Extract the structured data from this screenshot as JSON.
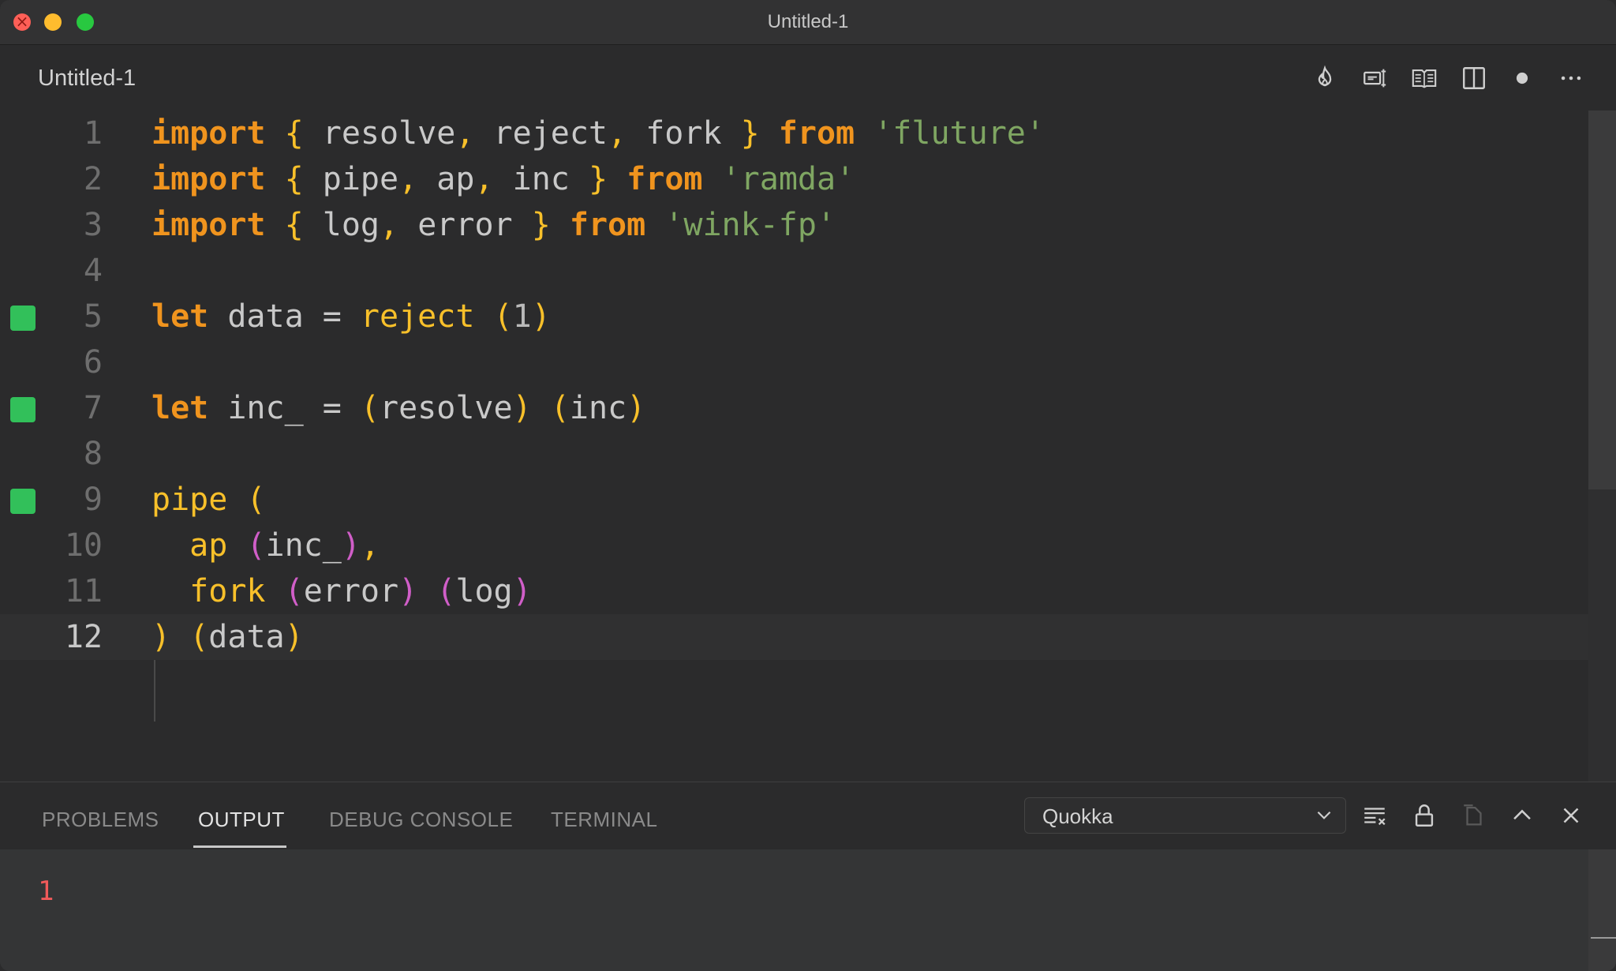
{
  "window": {
    "title": "Untitled-1"
  },
  "tab": {
    "title": "Untitled-1"
  },
  "editor_actions": [
    {
      "name": "quokka-icon"
    },
    {
      "name": "open-changes-icon"
    },
    {
      "name": "open-preview-icon"
    },
    {
      "name": "split-editor-icon"
    },
    {
      "name": "unsaved-dot-icon"
    },
    {
      "name": "more-actions-icon"
    }
  ],
  "code": {
    "line_numbers": [
      "1",
      "2",
      "3",
      "4",
      "5",
      "6",
      "7",
      "8",
      "9",
      "10",
      "11",
      "12"
    ],
    "coverage_marked_lines": [
      5,
      7,
      9
    ],
    "current_line": 12,
    "lines": [
      [
        [
          "kw",
          "import"
        ],
        [
          "id",
          " "
        ],
        [
          "br",
          "{"
        ],
        [
          "id",
          " resolve"
        ],
        [
          "br",
          ","
        ],
        [
          "id",
          " reject"
        ],
        [
          "br",
          ","
        ],
        [
          "id",
          " fork "
        ],
        [
          "br",
          "}"
        ],
        [
          "id",
          " "
        ],
        [
          "kw",
          "from"
        ],
        [
          "id",
          " "
        ],
        [
          "str",
          "'fluture'"
        ]
      ],
      [
        [
          "kw",
          "import"
        ],
        [
          "id",
          " "
        ],
        [
          "br",
          "{"
        ],
        [
          "id",
          " pipe"
        ],
        [
          "br",
          ","
        ],
        [
          "id",
          " ap"
        ],
        [
          "br",
          ","
        ],
        [
          "id",
          " inc "
        ],
        [
          "br",
          "}"
        ],
        [
          "id",
          " "
        ],
        [
          "kw",
          "from"
        ],
        [
          "id",
          " "
        ],
        [
          "str",
          "'ramda'"
        ]
      ],
      [
        [
          "kw",
          "import"
        ],
        [
          "id",
          " "
        ],
        [
          "br",
          "{"
        ],
        [
          "id",
          " log"
        ],
        [
          "br",
          ","
        ],
        [
          "id",
          " error "
        ],
        [
          "br",
          "}"
        ],
        [
          "id",
          " "
        ],
        [
          "kw",
          "from"
        ],
        [
          "id",
          " "
        ],
        [
          "str",
          "'wink-fp'"
        ]
      ],
      [],
      [
        [
          "kw",
          "let"
        ],
        [
          "id",
          " data = "
        ],
        [
          "fn",
          "reject"
        ],
        [
          "id",
          " "
        ],
        [
          "br",
          "("
        ],
        [
          "num",
          "1"
        ],
        [
          "br",
          ")"
        ]
      ],
      [],
      [
        [
          "kw",
          "let"
        ],
        [
          "id",
          " inc_ = "
        ],
        [
          "br",
          "("
        ],
        [
          "id",
          "resolve"
        ],
        [
          "br",
          ")"
        ],
        [
          "id",
          " "
        ],
        [
          "br",
          "("
        ],
        [
          "id",
          "inc"
        ],
        [
          "br",
          ")"
        ]
      ],
      [],
      [
        [
          "fn",
          "pipe"
        ],
        [
          "id",
          " "
        ],
        [
          "br",
          "("
        ]
      ],
      [
        [
          "id",
          "  "
        ],
        [
          "fn",
          "ap"
        ],
        [
          "id",
          " "
        ],
        [
          "pk",
          "("
        ],
        [
          "id",
          "inc_"
        ],
        [
          "pk",
          ")"
        ],
        [
          "br",
          ","
        ]
      ],
      [
        [
          "id",
          "  "
        ],
        [
          "fn",
          "fork"
        ],
        [
          "id",
          " "
        ],
        [
          "pk",
          "("
        ],
        [
          "id",
          "error"
        ],
        [
          "pk",
          ")"
        ],
        [
          "id",
          " "
        ],
        [
          "pk",
          "("
        ],
        [
          "id",
          "log"
        ],
        [
          "pk",
          ")"
        ]
      ],
      [
        [
          "br",
          ")"
        ],
        [
          "id",
          " "
        ],
        [
          "br",
          "("
        ],
        [
          "id",
          "data"
        ],
        [
          "br",
          ")"
        ]
      ]
    ]
  },
  "panel": {
    "tabs": [
      "PROBLEMS",
      "OUTPUT",
      "DEBUG CONSOLE",
      "TERMINAL"
    ],
    "active_tab": "OUTPUT",
    "channel": "Quokka",
    "output_lines": [
      "1"
    ],
    "output_color": "#f05a5a"
  },
  "colors": {
    "keyword": "#f0941e",
    "bracket": "#f8c02a",
    "bracket_nested": "#d05ec8",
    "string": "#7fa662",
    "coverage": "#32c05a"
  }
}
